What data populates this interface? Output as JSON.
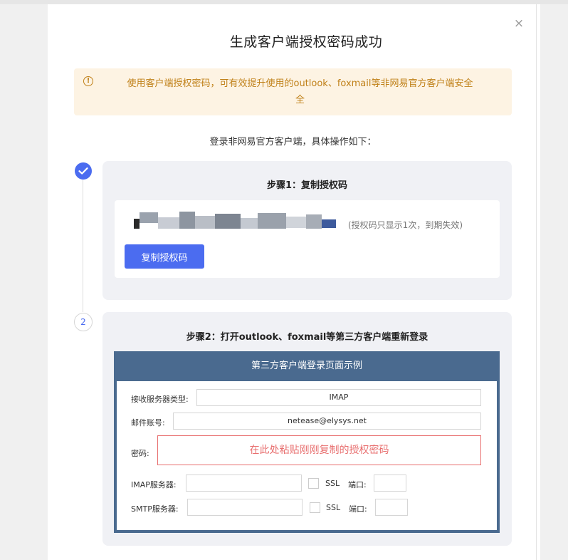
{
  "dialog": {
    "title": "生成客户端授权密码成功",
    "close_label": "×",
    "notice_icon": "!",
    "notice_text": "使用客户端授权密码，可有效提升使用的outlook、foxmail等非网易官方客户端安全",
    "notice_text_line2": "全",
    "subtitle": "登录非网易官方客户端，具体操作如下："
  },
  "steps": [
    {
      "status": "done",
      "icon": "check-icon",
      "title": "步骤1：复制授权码",
      "code_hint": "(授权码只显示1次，到期失效)",
      "copy_button": "复制授权码"
    },
    {
      "status": "pending",
      "number": "2",
      "title": "步骤2：打开outlook、foxmail等第三方客户端重新登录"
    }
  ],
  "example": {
    "header": "第三方客户端登录页面示例",
    "server_type_label": "接收服务器类型:",
    "server_type_value": "IMAP",
    "account_label": "邮件账号:",
    "account_value": "netease@elysys.net",
    "password_label": "密码:",
    "password_hint": "在此处粘贴刚刚复制的授权密码",
    "imap_label": "IMAP服务器:",
    "smtp_label": "SMTP服务器:",
    "ssl_label": "SSL",
    "port_label": "端口:"
  },
  "colors": {
    "accent": "#4b6cf0",
    "warning_bg": "#fdf3e3",
    "warning_text": "#c08018",
    "example_header": "#4a6a8f",
    "highlight_red": "#e86f6f"
  }
}
